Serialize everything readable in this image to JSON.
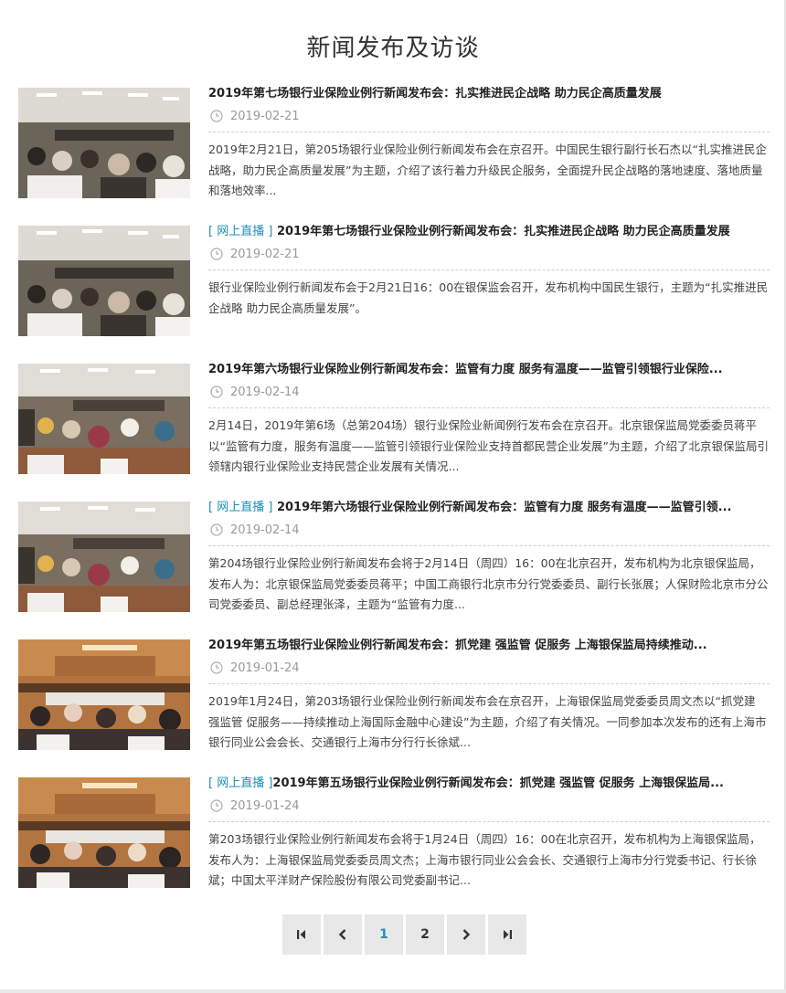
{
  "page": {
    "title": "新闻发布及访谈"
  },
  "news": [
    {
      "tag": "",
      "title": "2019年第七场银行业保险业例行新闻发布会：扎实推进民企战略 助力民企高质量发展",
      "date": "2019-02-21",
      "summary": "2019年2月21日，第205场银行业保险业例行新闻发布会在京召开。中国民生银行副行长石杰以“扎实推进民企战略，助力民企高质量发展”为主题，介绍了该行着力升级民企服务，全面提升民企战略的落地速度、落地质量和落地效率..."
    },
    {
      "tag": "[ 网上直播 ]",
      "title": "2019年第七场银行业保险业例行新闻发布会：扎实推进民企战略 助力民企高质量发展",
      "date": "2019-02-21",
      "summary": "银行业保险业例行新闻发布会于2月21日16：00在银保监会召开，发布机构中国民生银行，主题为“扎实推进民企战略 助力民企高质量发展”。"
    },
    {
      "tag": "",
      "title": "2019年第六场银行业保险业例行新闻发布会：监管有力度 服务有温度——监管引领银行业保险...",
      "date": "2019-02-14",
      "summary": "2月14日，2019年第6场（总第204场）银行业保险业新闻例行发布会在京召开。北京银保监局党委委员蒋平以“监管有力度，服务有温度——监管引领银行业保险业支持首都民营企业发展”为主题，介绍了北京银保监局引领辖内银行业保险业支持民营企业发展有关情况..."
    },
    {
      "tag": "[ 网上直播 ]",
      "title": "2019年第六场银行业保险业例行新闻发布会：监管有力度 服务有温度——监管引领...",
      "date": "2019-02-14",
      "summary": "第204场银行业保险业例行新闻发布会将于2月14日（周四）16：00在北京召开，发布机构为北京银保监局，发布人为：北京银保监局党委委员蒋平；中国工商银行北京市分行党委委员、副行长张展；人保财险北京市分公司党委委员、副总经理张泽，主题为“监管有力度..."
    },
    {
      "tag": "",
      "title": "2019年第五场银行业保险业例行新闻发布会：抓党建 强监管 促服务 上海银保监局持续推动...",
      "date": "2019-01-24",
      "summary": "2019年1月24日，第203场银行业保险业例行新闻发布会在京召开，上海银保监局党委委员周文杰以“抓党建 强监管 促服务——持续推动上海国际金融中心建设”为主题，介绍了有关情况。一同参加本次发布的还有上海市银行同业公会会长、交通银行上海市分行行长徐斌..."
    },
    {
      "tag": "[ 网上直播 ]",
      "title": "2019年第五场银行业保险业例行新闻发布会：抓党建 强监管 促服务 上海银保监局...",
      "date": "2019-01-24",
      "summary": "第203场银行业保险业例行新闻发布会将于1月24日（周四）16：00在北京召开，发布机构为上海银保监局，发布人为：上海银保监局党委委员周文杰；上海市银行同业公会会长、交通银行上海市分行党委书记、行长徐斌；中国太平洋财产保险股份有限公司党委副书记..."
    }
  ],
  "pagination": {
    "first": "first-page-icon",
    "prev": "prev-page-icon",
    "pages": [
      "1",
      "2"
    ],
    "current": "1",
    "next": "next-page-icon",
    "last": "last-page-icon"
  },
  "colors": {
    "tag": "#1d8fb9",
    "current_page": "#2a8fb0",
    "pager_bg": "#e8e8e8"
  }
}
